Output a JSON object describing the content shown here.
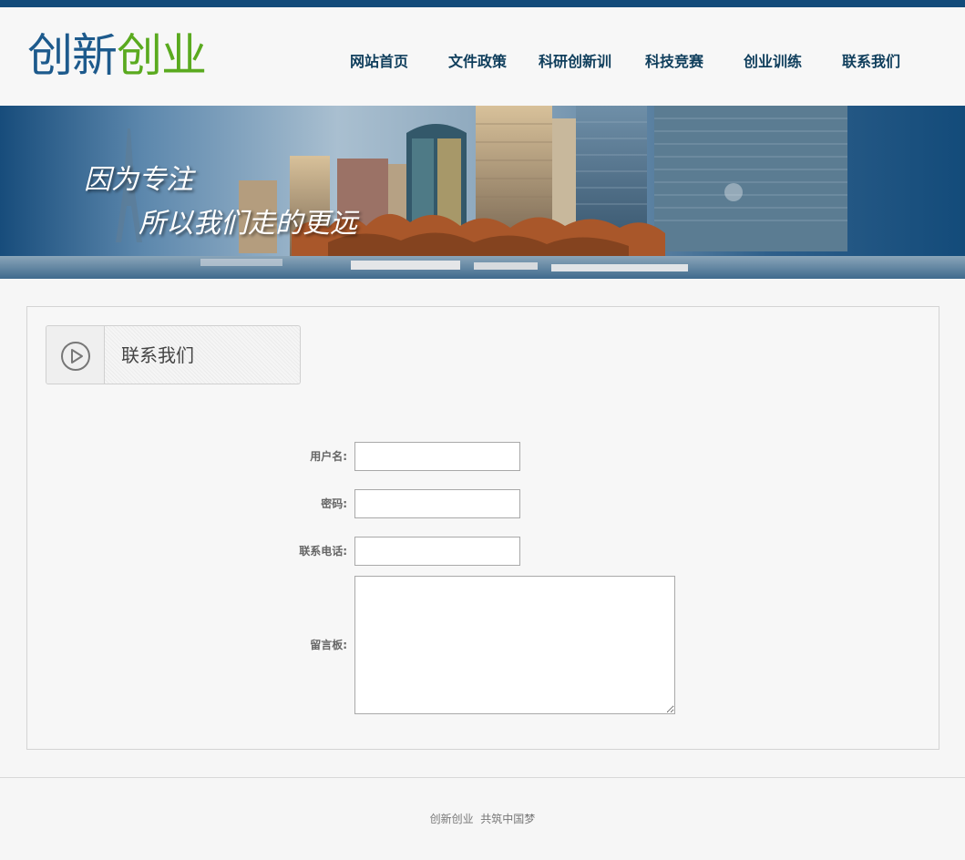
{
  "header": {
    "logo_part1": "创新",
    "logo_part2": "创业"
  },
  "nav": {
    "items": [
      {
        "label": "网站首页"
      },
      {
        "label": "文件政策"
      },
      {
        "label": "科研创新训"
      },
      {
        "label": "科技竞赛"
      },
      {
        "label": "创业训练"
      },
      {
        "label": "联系我们"
      }
    ]
  },
  "banner": {
    "slogan_line1": "因为专注",
    "slogan_line2": "所以我们走的更远"
  },
  "section": {
    "title": "联系我们",
    "icon": "play-circle-icon"
  },
  "form": {
    "username_label": "用户名:",
    "username_value": "",
    "password_label": "密码:",
    "password_value": "",
    "phone_label": "联系电话:",
    "phone_value": "",
    "message_label": "留言板:",
    "message_value": ""
  },
  "footer": {
    "text": "创新创业  共筑中国梦"
  },
  "colors": {
    "topbar": "#134b7a",
    "logo_blue": "#1d5a8c",
    "logo_green": "#5aaa1f",
    "nav_text": "#0f3e5c"
  }
}
